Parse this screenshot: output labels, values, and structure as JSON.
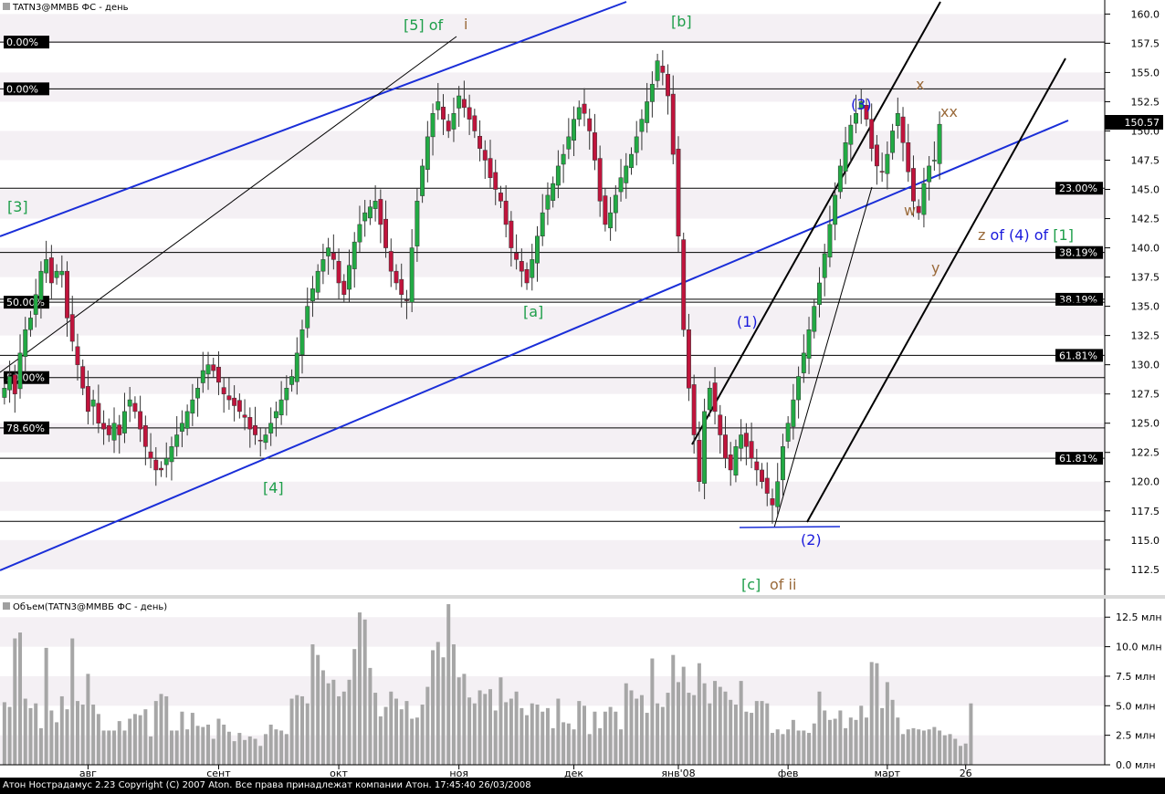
{
  "price_panel": {
    "title": "TATN3@ММВБ ФС - день",
    "last_price_label": "150.57",
    "last_price": 150.57
  },
  "volume_panel": {
    "title": "Объем(TATN3@ММВБ ФС - день)"
  },
  "status_bar": {
    "text": "Атон Нострадамус 2.23 Copyright (C) 2007 Aton. Все права принадлежат компании Атон. 17:45:40 26/03/2008"
  },
  "colors": {
    "up_candle": "#22aa44",
    "down_candle": "#c0143c",
    "blue_lines": "#1a2ed8",
    "wave_green": "#1e9e4a",
    "wave_brown": "#9a6a3a",
    "wave_blue": "#1a1adc",
    "volume_bars": "#a6a6a6"
  },
  "chart_data": [
    {
      "type": "candlestick",
      "title": "TATN3@ММВБ ФС - день",
      "ylim": [
        110.3,
        161.2
      ],
      "y_ticks": [
        "160.0",
        "157.5",
        "155.0",
        "152.5",
        "150.0",
        "147.5",
        "145.0",
        "142.5",
        "140.0",
        "137.5",
        "135.0",
        "132.5",
        "130.0",
        "127.5",
        "125.0",
        "122.5",
        "120.0",
        "117.5",
        "115.0",
        "112.5"
      ],
      "x_labels": [
        "авг",
        "сент",
        "окт",
        "ноя",
        "дек",
        "янв'08",
        "фев",
        "март",
        "26"
      ],
      "x_label_index": [
        16,
        41,
        64,
        87,
        109,
        129,
        150,
        169,
        184
      ],
      "n_bars": 187,
      "close_series": [
        128,
        129,
        127.5,
        131,
        133,
        134,
        136,
        138,
        139,
        137,
        138,
        138,
        134,
        132,
        130,
        128,
        126,
        127,
        125,
        124.5,
        124,
        125,
        124,
        126,
        127,
        126,
        124.5,
        123,
        122,
        121,
        121,
        122,
        123,
        124,
        125,
        126,
        127,
        128,
        129.5,
        130,
        129.5,
        128.5,
        127.5,
        127,
        126.5,
        126,
        125.5,
        124.5,
        124,
        123.5,
        124,
        125,
        126,
        127,
        128,
        129,
        131,
        133,
        135,
        136.5,
        138,
        139,
        140,
        139,
        137,
        136,
        138.5,
        140.5,
        142,
        143,
        143.5,
        144,
        142,
        140,
        138,
        137,
        136,
        135.5,
        140,
        144,
        147,
        149.5,
        151.5,
        152.5,
        151,
        150,
        151.5,
        153,
        152,
        151,
        150,
        148.5,
        147.5,
        146,
        145,
        144,
        142,
        140,
        139,
        138,
        137,
        139,
        141,
        143,
        144.5,
        145.5,
        147,
        148,
        149.5,
        151,
        152,
        151.5,
        150,
        147.5,
        144,
        142,
        143,
        144.5,
        146,
        147,
        148,
        149.5,
        151,
        152.5,
        154,
        156,
        155,
        153,
        148,
        141,
        133,
        128,
        124,
        120,
        126,
        128,
        126,
        124,
        122,
        121,
        123,
        124,
        123,
        122,
        121,
        120,
        119,
        118,
        120,
        123,
        125,
        127,
        129,
        131,
        133,
        135,
        137,
        139.5,
        142,
        144.5,
        147,
        149,
        150.5,
        151.5,
        152.5,
        151,
        148.5,
        147,
        146.5,
        148,
        150,
        151.5,
        149,
        146.5,
        144,
        143,
        145.5,
        147,
        147.5,
        150.57
      ]
    },
    {
      "type": "bar",
      "title": "Объем(TATN3@ММВБ ФС - день)",
      "ylim": [
        0,
        13.6
      ],
      "unit": "млн",
      "y_ticks": [
        "12.5 млн",
        "10.0 млн",
        "7.5 млн",
        "5.0 млн",
        "2.5 млн",
        "0.0 млн"
      ],
      "values": [
        5.3,
        4.9,
        10.7,
        11.2,
        5.6,
        4.8,
        5.2,
        3.1,
        9.9,
        4.6,
        3.6,
        5.8,
        4.7,
        10.7,
        5.4,
        5.1,
        7.7,
        5.1,
        4.3,
        2.9,
        2.9,
        2.9,
        3.7,
        2.9,
        3.9,
        4.3,
        4.2,
        4.7,
        2.4,
        5.4,
        6.0,
        5.8,
        2.9,
        2.9,
        4.5,
        3.0,
        4.4,
        3.3,
        3.2,
        3.4,
        2.2,
        3.9,
        3.4,
        2.8,
        2.0,
        2.7,
        2.1,
        2.4,
        2.2,
        1.6,
        2.6,
        3.4,
        3.0,
        2.9,
        2.6,
        5.6,
        5.9,
        5.8,
        5.2,
        10.2,
        9.3,
        8.0,
        6.9,
        7.2,
        5.8,
        6.2,
        7.2,
        9.8,
        12.9,
        12.3,
        8.2,
        6.1,
        4.1,
        4.9,
        6.2,
        5.6,
        4.7,
        5.4,
        3.9,
        4.0,
        5.1,
        6.6,
        9.7,
        10.4,
        9.1,
        13.6,
        10.2,
        7.4,
        7.7,
        5.7,
        5.2,
        6.3,
        6.0,
        6.4,
        4.6,
        7.4,
        5.3,
        5.6,
        6.2,
        4.8,
        4.2,
        5.2,
        5.1,
        4.5,
        4.8,
        3.1,
        5.6,
        3.6,
        3.5,
        3.0,
        5.4,
        5.0,
        2.6,
        4.5,
        3.1,
        4.5,
        4.9,
        4.5,
        3.0,
        6.9,
        6.3,
        5.6,
        5.9,
        4.4,
        9.0,
        5.2,
        4.9,
        6.1,
        9.3,
        7.0,
        8.3,
        6.1,
        5.9,
        8.6,
        6.9,
        5.2,
        7.1,
        6.6,
        6.2,
        5.5,
        5.1,
        7.1,
        4.5,
        4.4,
        5.4,
        5.4,
        5.2,
        2.7,
        3.0,
        2.6,
        3.0,
        3.8,
        2.9,
        2.9,
        2.7,
        3.5,
        6.2,
        4.6,
        3.8,
        3.9,
        4.6,
        3.1,
        4.0,
        3.8,
        5.0,
        4.0,
        8.7,
        8.6,
        4.8,
        7.0,
        5.5,
        4.0,
        2.6,
        3.0,
        3.1,
        3.0,
        2.9,
        3.0,
        3.2,
        2.9,
        2.5,
        2.6,
        2.2,
        1.6,
        1.8,
        5.2
      ]
    }
  ],
  "horizontal_levels": [
    {
      "price": 157.6,
      "label": "0.00%",
      "side": "left"
    },
    {
      "price": 153.6,
      "label": "0.00%",
      "side": "left"
    },
    {
      "price": 145.1,
      "label": "23.00%",
      "side": "right"
    },
    {
      "price": 139.6,
      "label": "38.19%",
      "side": "right"
    },
    {
      "price": 135.6,
      "label": "38.19%",
      "side": "right"
    },
    {
      "price": 135.35,
      "label": "50.00%",
      "side": "left"
    },
    {
      "price": 130.8,
      "label": "61.81%",
      "side": "right"
    },
    {
      "price": 128.9,
      "label": "50.00%",
      "side": "left"
    },
    {
      "price": 124.6,
      "label": "78.60%",
      "side": "left"
    },
    {
      "price": 122.0,
      "label": "61.81%",
      "side": "right"
    },
    {
      "price": 116.6,
      "label": "",
      "side": "none"
    }
  ],
  "wave_labels": [
    {
      "text": "[3]",
      "color": "green"
    },
    {
      "text": "[5] of",
      "color": "green"
    },
    {
      "text": "i",
      "color": "brown"
    },
    {
      "text": "[b]",
      "color": "green"
    },
    {
      "text": "[a]",
      "color": "green"
    },
    {
      "text": "[4]",
      "color": "green"
    },
    {
      "text": "[c]",
      "color": "green"
    },
    {
      "text": "of ii",
      "color": "brown"
    },
    {
      "text": "(1)",
      "color": "blue"
    },
    {
      "text": "(2)",
      "color": "blue"
    },
    {
      "text": "(3)",
      "color": "blue"
    },
    {
      "text": "x",
      "color": "brown"
    },
    {
      "text": "xx",
      "color": "brown"
    },
    {
      "text": "w",
      "color": "brown"
    },
    {
      "text": "y",
      "color": "brown"
    },
    {
      "text": "z of (4) of [1]",
      "color": "mixed"
    }
  ]
}
